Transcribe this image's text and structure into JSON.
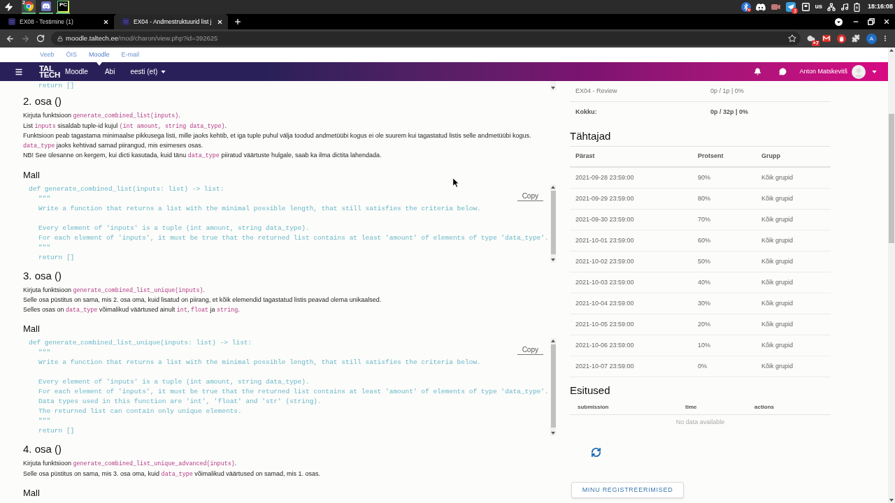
{
  "system_bar": {
    "window_count": "2",
    "app_logo_text": "PC",
    "tray_badge": "3",
    "keyboard_layout": "us",
    "clock": "18:16:08"
  },
  "browser": {
    "tabs": [
      {
        "title": "EX08 - Testimine (1)",
        "selected": false
      },
      {
        "title": "EX04 - Andmestruktuurid list j",
        "selected": true
      }
    ],
    "forward_disabled": true,
    "url": {
      "host": "moodle.taltech.ee",
      "path": "/mod/charon/view.php?id=392625"
    },
    "extension_badge": "+7",
    "profile_initial": "A"
  },
  "site_links": [
    {
      "label": "Veeb",
      "selected": false
    },
    {
      "label": "ÕIS",
      "selected": false
    },
    {
      "label": "Moodle",
      "selected": true
    },
    {
      "label": "E-mail",
      "selected": false
    }
  ],
  "navbar": {
    "logo": [
      "TAL",
      "TECH"
    ],
    "items": [
      "Moodle",
      "Abi"
    ],
    "language": "eesti (et)",
    "user": "Anton Matskevitš"
  },
  "content": {
    "previous_code": [
      {
        "kind": "line",
        "children": [
          {
            "kind": "line",
            "text": "return []"
          }
        ]
      }
    ],
    "parts": [
      {
        "title": "2. osa ()",
        "lines": [
          [
            {
              "kind": "text",
              "text": "Kirjuta funktsioon "
            },
            {
              "kind": "code",
              "text": "generate_combined_list(inputs)"
            },
            {
              "kind": "text",
              "text": "."
            }
          ],
          [
            {
              "kind": "text",
              "text": "List "
            },
            {
              "kind": "code",
              "text": "inputs"
            },
            {
              "kind": "text",
              "text": " sisaldab tuple-id kujul "
            },
            {
              "kind": "code",
              "text": "(int amount, string data_type)"
            },
            {
              "kind": "text",
              "text": "."
            }
          ],
          [
            {
              "kind": "text",
              "text": "Funktsioon peab tagastama minimaalse pikkusega listi, mille jaoks kehtib, et iga tuple puhul välja toodud andmetüübi kogus ei ole suurem kui tagastatud listis selle andmetüübi kogus."
            }
          ],
          [
            {
              "kind": "code",
              "text": "data_type"
            },
            {
              "kind": "text",
              "text": " jaoks kehtivad samad piirangud, mis esimeses osas."
            }
          ],
          [
            {
              "kind": "text",
              "text": "NB! See ülesanne on kergem, kui dicti kasutada, kuid tänu "
            },
            {
              "kind": "code",
              "text": "data_type"
            },
            {
              "kind": "text",
              "text": " piiratud väärtuste hulgale, saab ka ilma dictita lahendada."
            }
          ]
        ],
        "template": {
          "title": "Mall",
          "copy": "Copy",
          "code": [
            {
              "kind": "line",
              "text": "def generate_combined_list(inputs: list) -> list:",
              "children": [
                {
                  "kind": "line",
                  "text": "\"\"\""
                },
                {
                  "kind": "line",
                  "text": "Write a function that returns a list with the minimal possible length, that still satisfies the criteria below."
                },
                {
                  "kind": "blank"
                },
                {
                  "kind": "line",
                  "text": "Every element of 'inputs' is a tuple (int amount, string data_type)."
                },
                {
                  "kind": "line",
                  "text": "For each element of 'inputs', it must be true that the returned list contains at least 'amount' of elements of type 'data_type'."
                },
                {
                  "kind": "line",
                  "text": "\"\"\""
                },
                {
                  "kind": "line",
                  "text": "return []"
                }
              ]
            }
          ]
        }
      },
      {
        "title": "3. osa ()",
        "lines": [
          [
            {
              "kind": "text",
              "text": "Kirjuta funktsioon "
            },
            {
              "kind": "code",
              "text": "generate_combined_list_unique(inputs)"
            },
            {
              "kind": "text",
              "text": "."
            }
          ],
          [
            {
              "kind": "text",
              "text": "Selle osa püstitus on sama, mis 2. osa oma, kuid lisatud on piirang, et kõik elemendid tagastatud listis peavad olema unikaalsed."
            }
          ],
          [
            {
              "kind": "text",
              "text": "Selles osas on "
            },
            {
              "kind": "code",
              "text": "data_type"
            },
            {
              "kind": "text",
              "text": " võimalikud väärtused ainult "
            },
            {
              "kind": "code",
              "text": "int"
            },
            {
              "kind": "text",
              "text": ", "
            },
            {
              "kind": "code",
              "text": "float"
            },
            {
              "kind": "text",
              "text": " ja "
            },
            {
              "kind": "code",
              "text": "string"
            },
            {
              "kind": "text",
              "text": "."
            }
          ]
        ],
        "template": {
          "title": "Mall",
          "copy": "Copy",
          "code": [
            {
              "kind": "line",
              "text": "def generate_combined_list_unique(inputs: list) -> list:",
              "children": [
                {
                  "kind": "line",
                  "text": "\"\"\""
                },
                {
                  "kind": "line",
                  "text": "Write a function that returns a list with the minimal possible length, that still satisfies the criteria below."
                },
                {
                  "kind": "blank"
                },
                {
                  "kind": "line",
                  "text": "Every element of 'inputs' is a tuple (int amount, string data_type)."
                },
                {
                  "kind": "line",
                  "text": "For each element of 'inputs', it must be true that the returned list contains at least 'amount' of elements of type 'data_type'."
                },
                {
                  "kind": "line",
                  "text": "Data types used in this function are 'int', 'float' and 'str' (string)."
                },
                {
                  "kind": "line",
                  "text": "The returned list can contain only unique elements."
                },
                {
                  "kind": "line",
                  "text": "\"\"\""
                },
                {
                  "kind": "line",
                  "text": "return []"
                }
              ]
            }
          ]
        }
      },
      {
        "title": "4. osa ()",
        "lines": [
          [
            {
              "kind": "text",
              "text": "Kirjuta funktsioon "
            },
            {
              "kind": "code",
              "text": "generate_combined_list_unique_advanced(inputs)"
            },
            {
              "kind": "text",
              "text": "."
            }
          ],
          [
            {
              "kind": "text",
              "text": "Selle osa püstitus on sama, mis 3. osa oma, kuid "
            },
            {
              "kind": "code",
              "text": "data_type"
            },
            {
              "kind": "text",
              "text": " võimalikud väärtused on samad, mis 1. osas."
            }
          ]
        ],
        "template": {
          "title": "Mall"
        }
      }
    ]
  },
  "sidebar": {
    "summary": [
      {
        "label": "EX04 - Review",
        "value": "0p / 1p | 0%",
        "total": false
      },
      {
        "label": "Kokku:",
        "value": "0p / 32p | 0%",
        "total": true
      }
    ],
    "deadlines": {
      "title": "Tähtajad",
      "columns": [
        "Pärast",
        "Protsent",
        "Grupp"
      ],
      "rows": [
        [
          "2021-09-28 23:59:00",
          "90%",
          "Kõik grupid"
        ],
        [
          "2021-09-29 23:59:00",
          "80%",
          "Kõik grupid"
        ],
        [
          "2021-09-30 23:59:00",
          "70%",
          "Kõik grupid"
        ],
        [
          "2021-10-01 23:59:00",
          "60%",
          "Kõik grupid"
        ],
        [
          "2021-10-02 23:59:00",
          "50%",
          "Kõik grupid"
        ],
        [
          "2021-10-03 23:59:00",
          "40%",
          "Kõik grupid"
        ],
        [
          "2021-10-04 23:59:00",
          "30%",
          "Kõik grupid"
        ],
        [
          "2021-10-05 23:59:00",
          "20%",
          "Kõik grupid"
        ],
        [
          "2021-10-06 23:59:00",
          "10%",
          "Kõik grupid"
        ],
        [
          "2021-10-07 23:59:00",
          "0%",
          "Kõik grupid"
        ]
      ]
    },
    "submissions": {
      "title": "Esitused",
      "columns": [
        "submission",
        "time",
        "actions"
      ],
      "empty_text": "No data available"
    },
    "registrations_button": "MINU REGISTREERIMISED"
  }
}
